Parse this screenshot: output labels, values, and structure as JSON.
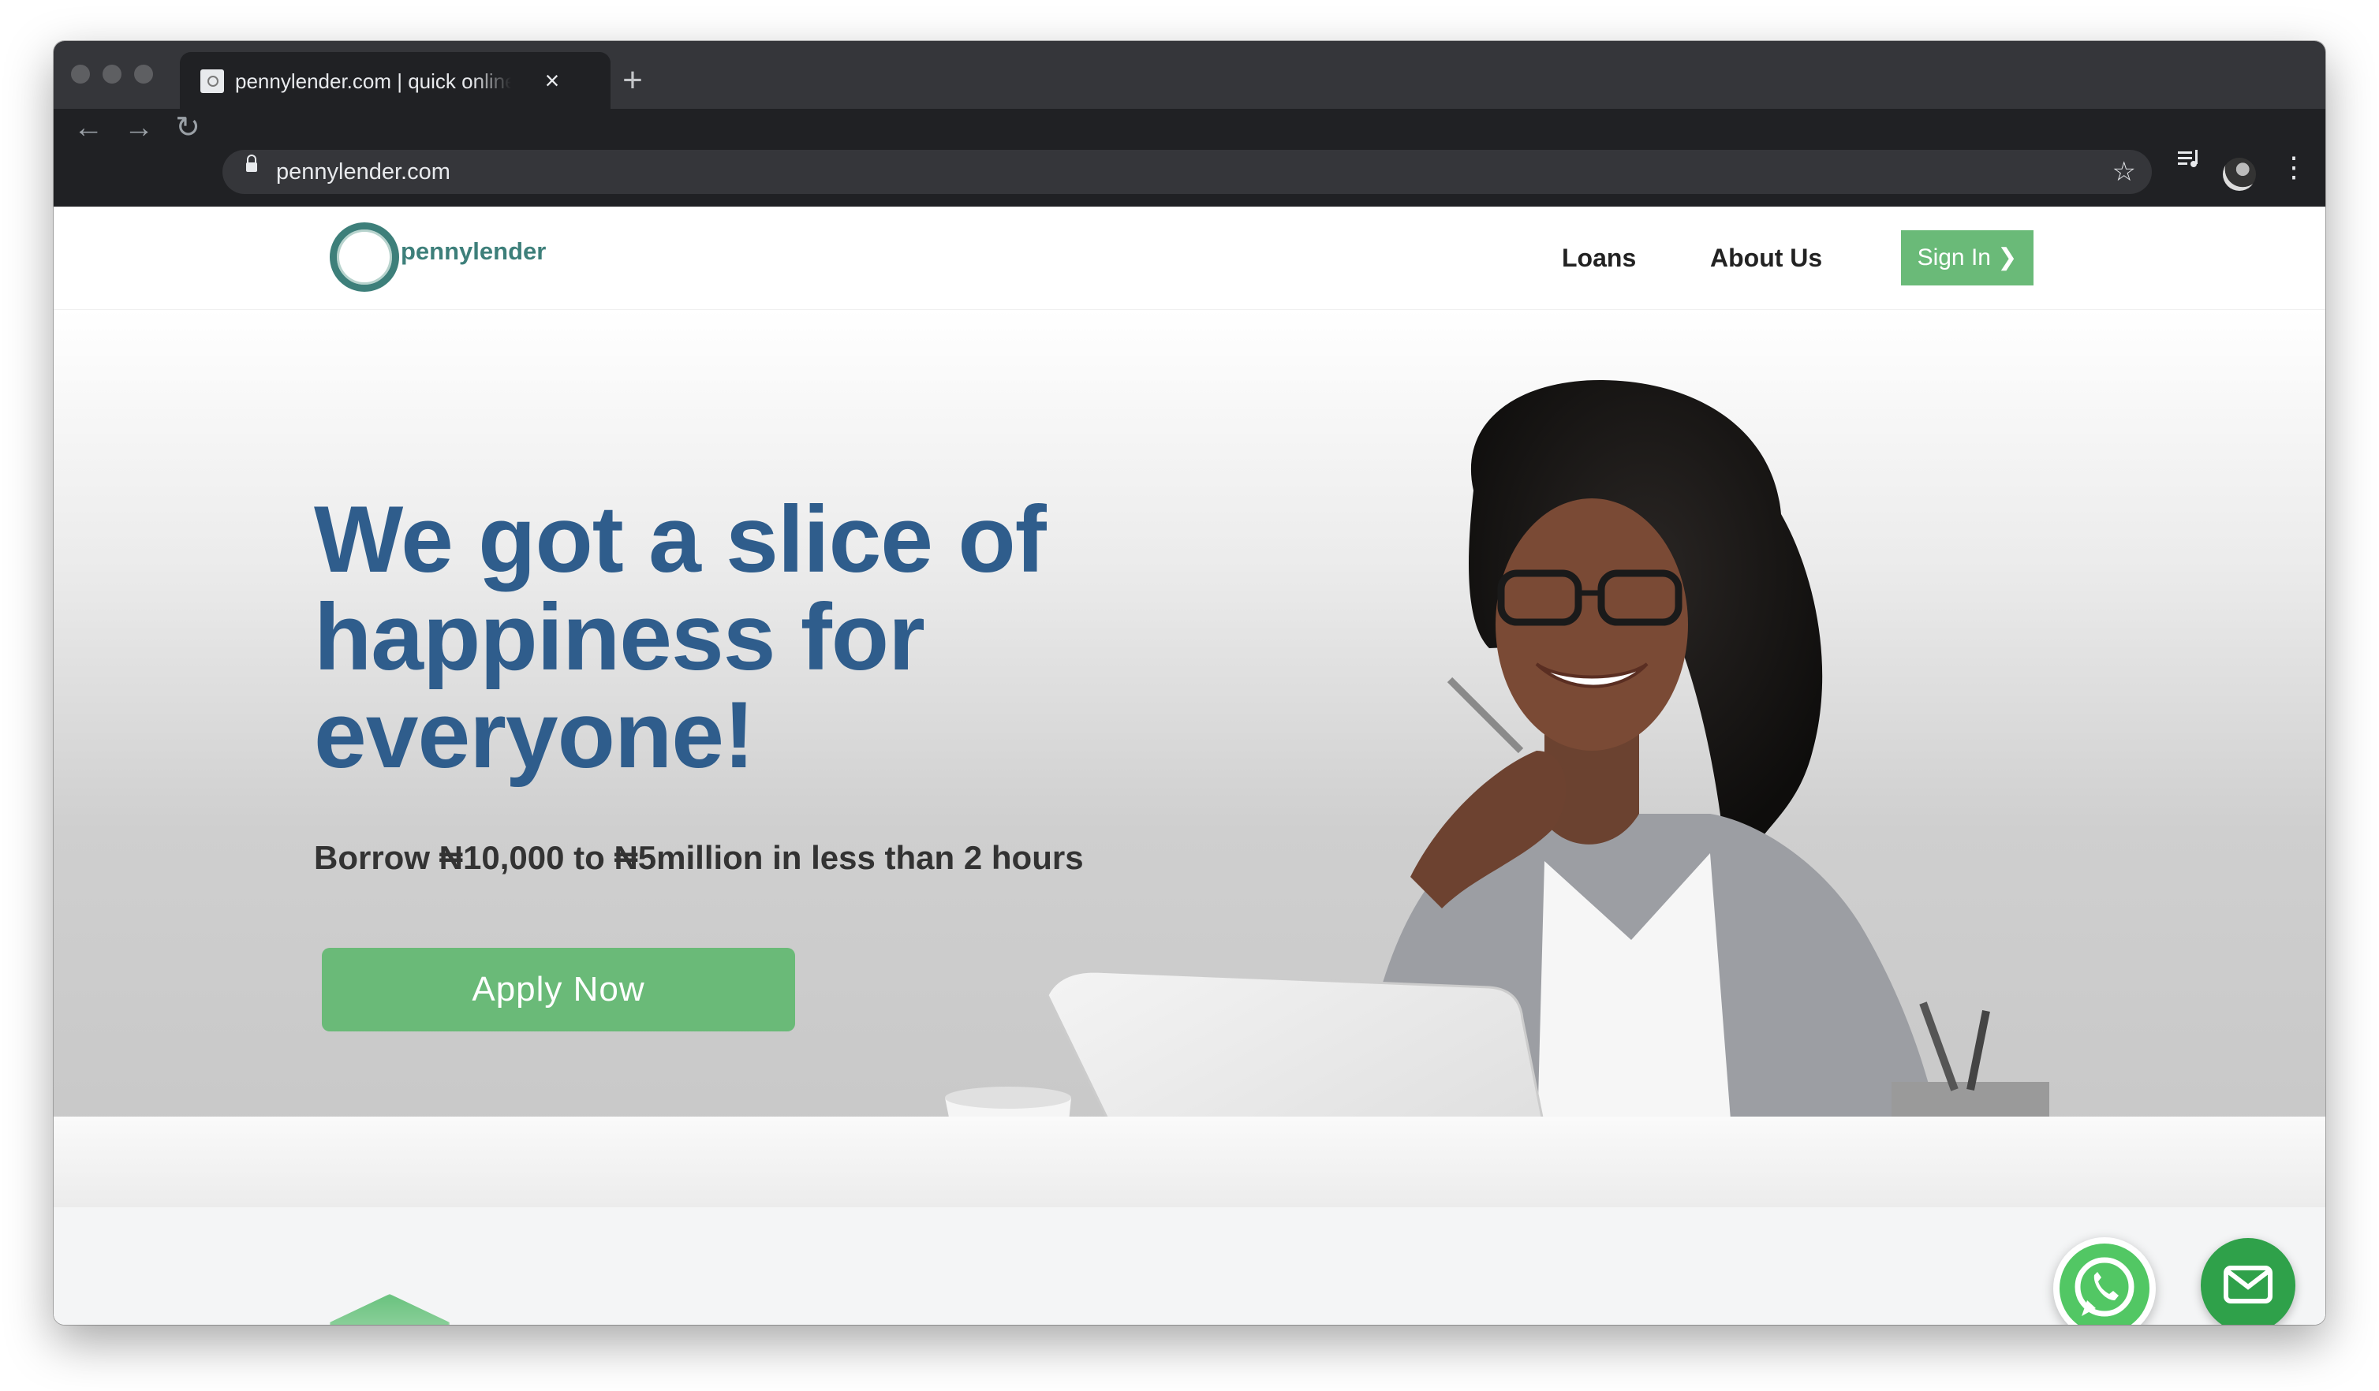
{
  "browser": {
    "tab_title": "pennylender.com | quick online loans",
    "tab_close": "×",
    "new_tab": "+",
    "url": "pennylender.com",
    "back": "←",
    "forward": "→",
    "reload": "↻",
    "bookmark": "☆",
    "menu": "⋮"
  },
  "site": {
    "logo_text": "pennylender",
    "nav": {
      "loans": "Loans",
      "about": "About Us",
      "signin": "Sign In ❯"
    },
    "hero": {
      "headline": "We got a slice of happiness for everyone!",
      "subheadline": "Borrow ₦10,000 to ₦5million in less than 2 hours",
      "cta": "Apply Now"
    }
  },
  "icons": [
    "whatsapp-icon",
    "email-icon",
    "lock-icon",
    "star-icon",
    "media-control-icon",
    "profile-avatar-icon",
    "kebab-menu-icon"
  ],
  "colors": {
    "brand_green": "#6aba78",
    "headline_blue": "#2f5d8c",
    "logo_teal": "#3d7f7a",
    "whatsapp_green": "#52c764",
    "email_green": "#2fa14a"
  }
}
